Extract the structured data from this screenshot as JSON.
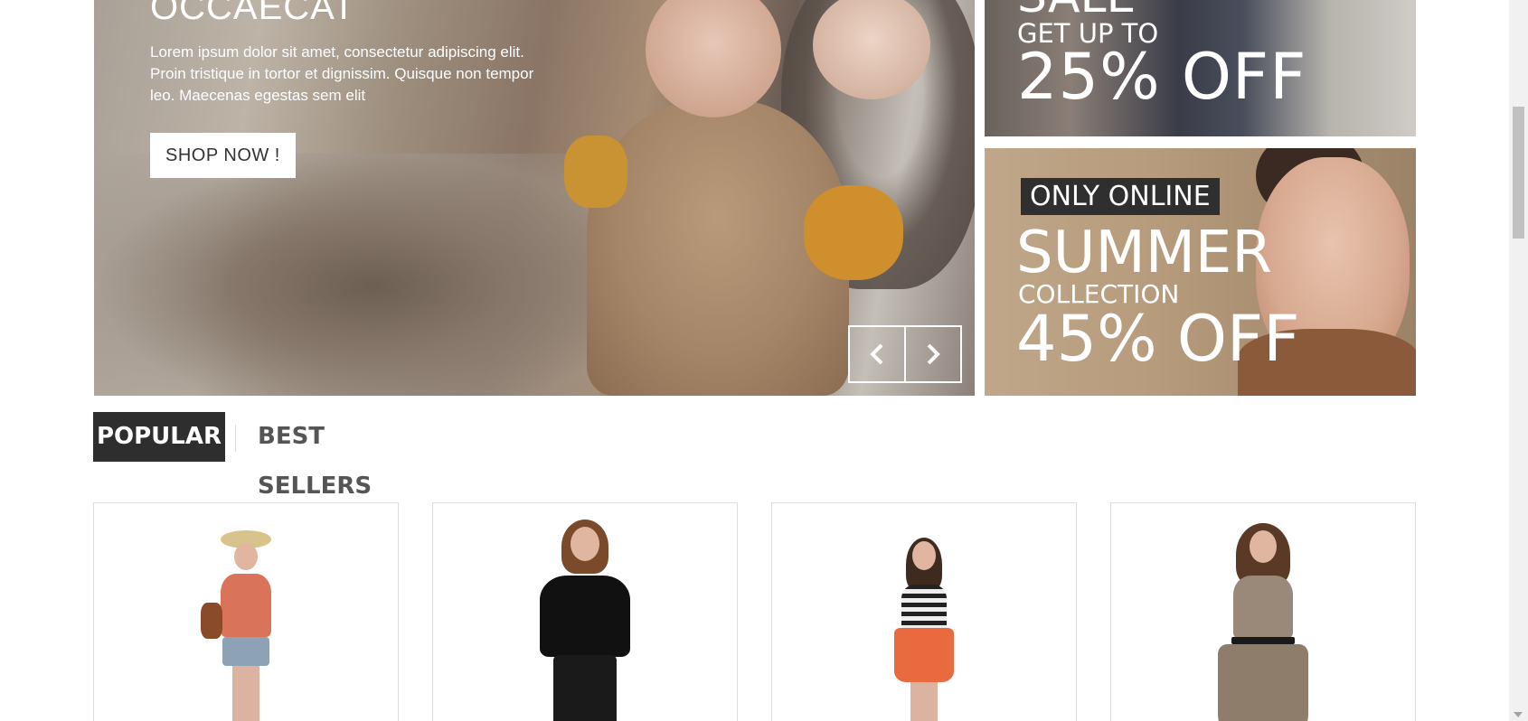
{
  "slider": {
    "title": "OCCAECAT",
    "text": "Lorem ipsum dolor sit amet, consectetur adipiscing elit. Proin tristique in tortor et dignissim. Quisque non tempor leo. Maecenas egestas sem elit",
    "button_label": "SHOP NOW !",
    "prev_icon": "chevron-left-icon",
    "next_icon": "chevron-right-icon"
  },
  "banner_top": {
    "sale": "SALE",
    "get_up_to": "GET UP TO",
    "discount": "25% OFF"
  },
  "banner_bottom": {
    "tag": "ONLY ONLINE",
    "summer": "SUMMER",
    "collection": "COLLECTION",
    "discount": "45% OFF"
  },
  "tabs": [
    {
      "label": "POPULAR",
      "active": true
    },
    {
      "label": "BEST SELLERS",
      "active": false
    }
  ],
  "colors": {
    "dark": "#2e2e2e",
    "accent_text": "#ffffff",
    "border": "#dddddd"
  }
}
